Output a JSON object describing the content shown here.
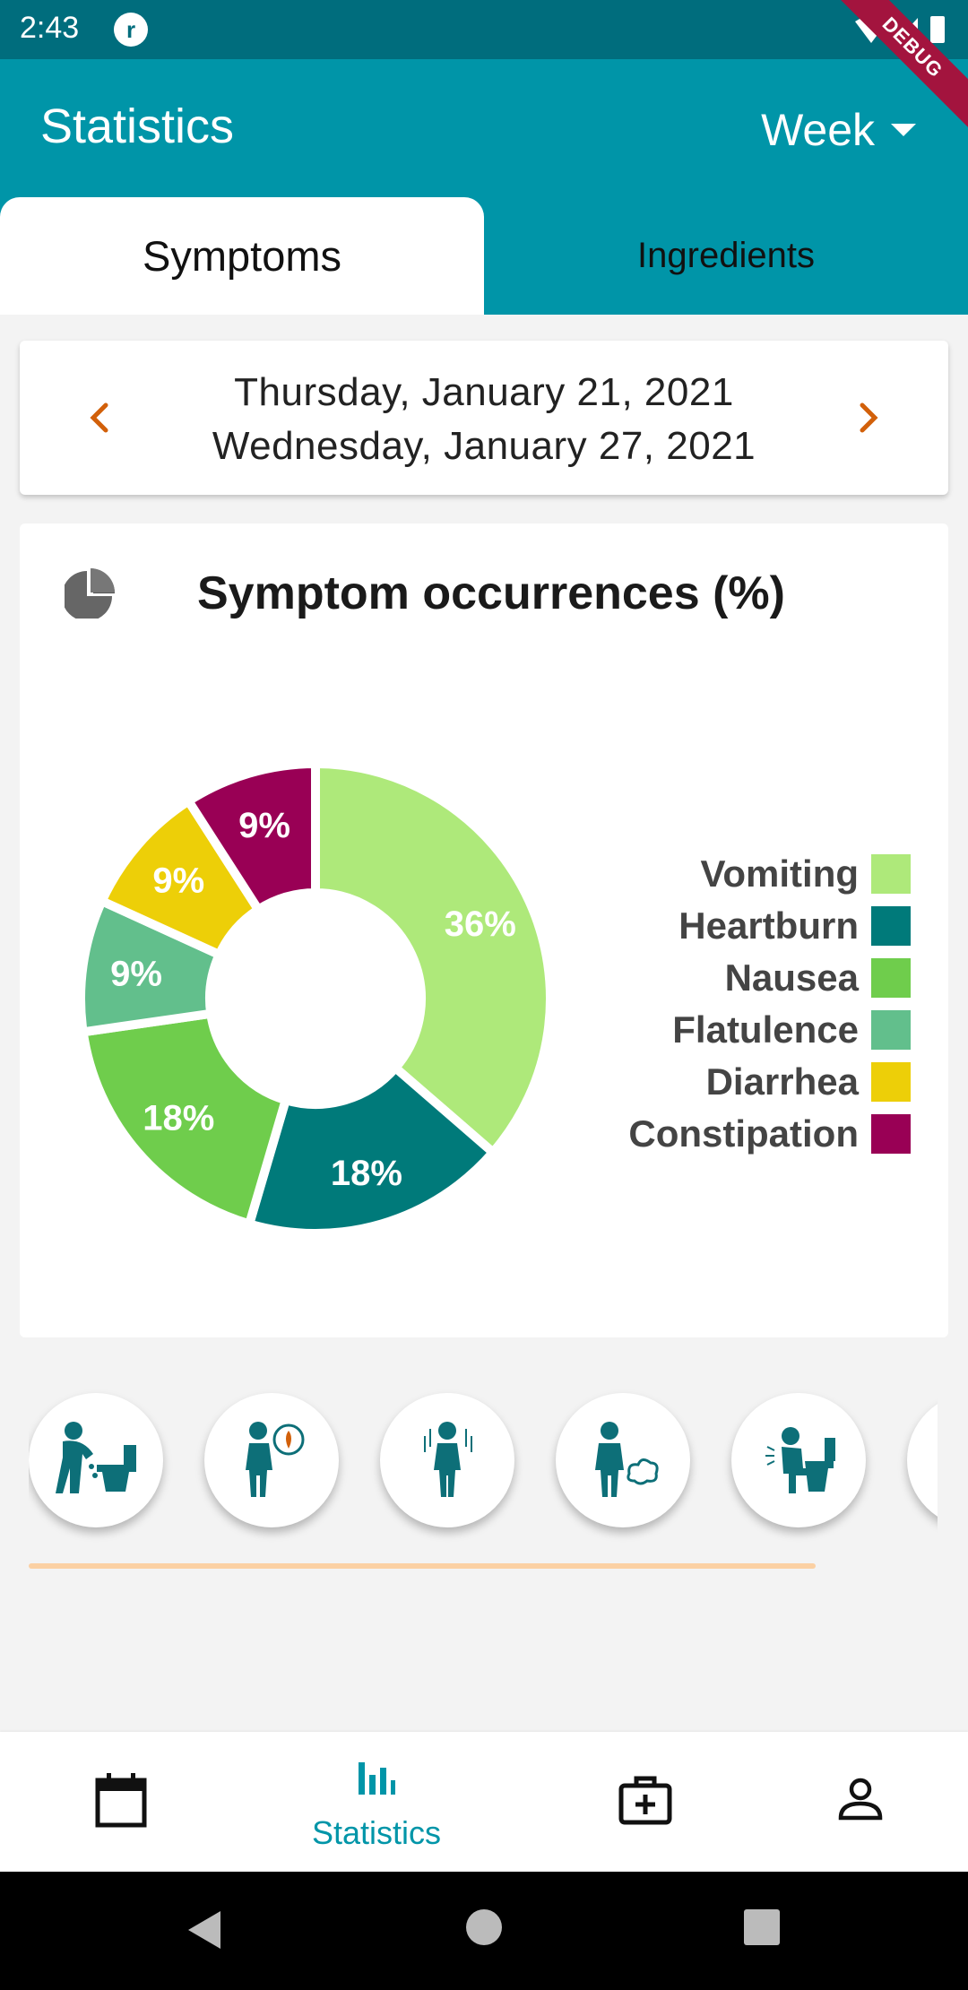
{
  "status_bar": {
    "time": "2:43",
    "debug_label": "DEBUG"
  },
  "app_bar": {
    "title": "Statistics",
    "period": "Week"
  },
  "tabs": [
    {
      "label": "Symptoms",
      "selected": true
    },
    {
      "label": "Ingredients",
      "selected": false
    }
  ],
  "date_range": {
    "start": "Thursday, January 21, 2021",
    "end": "Wednesday, January 27, 2021"
  },
  "chart_card": {
    "title": "Symptom occurrences (%)"
  },
  "chart_data": {
    "type": "pie",
    "title": "Symptom occurrences (%)",
    "donut": true,
    "legend_position": "right",
    "series": [
      {
        "name": "Vomiting",
        "value": 36,
        "label": "36%",
        "color": "#aee97a"
      },
      {
        "name": "Heartburn",
        "value": 18,
        "label": "18%",
        "color": "#007a7a"
      },
      {
        "name": "Nausea",
        "value": 18,
        "label": "18%",
        "color": "#6fcd4c"
      },
      {
        "name": "Flatulence",
        "value": 9,
        "label": "9%",
        "color": "#62bf8c"
      },
      {
        "name": "Diarrhea",
        "value": 9,
        "label": "9%",
        "color": "#edcf08"
      },
      {
        "name": "Constipation",
        "value": 9,
        "label": "9%",
        "color": "#990055"
      }
    ]
  },
  "symptom_icons": [
    "vomiting-person-icon",
    "heartburn-person-icon",
    "nausea-person-icon",
    "flatulence-person-icon",
    "toilet-sitting-person-icon",
    "partial-symptom-icon"
  ],
  "bottom_nav": {
    "items": [
      {
        "icon": "calendar-icon",
        "label": ""
      },
      {
        "icon": "bar-chart-icon",
        "label": "Statistics"
      },
      {
        "icon": "medical-kit-icon",
        "label": ""
      },
      {
        "icon": "person-icon",
        "label": ""
      }
    ],
    "active_color": "#0095a8"
  },
  "colors": {
    "status_bar": "#006d7d",
    "app_bar": "#0095a8",
    "arrow_accent": "#d2600a",
    "scroll_indicator": "#fbd0a3",
    "icon_teal": "#0d6f78"
  }
}
